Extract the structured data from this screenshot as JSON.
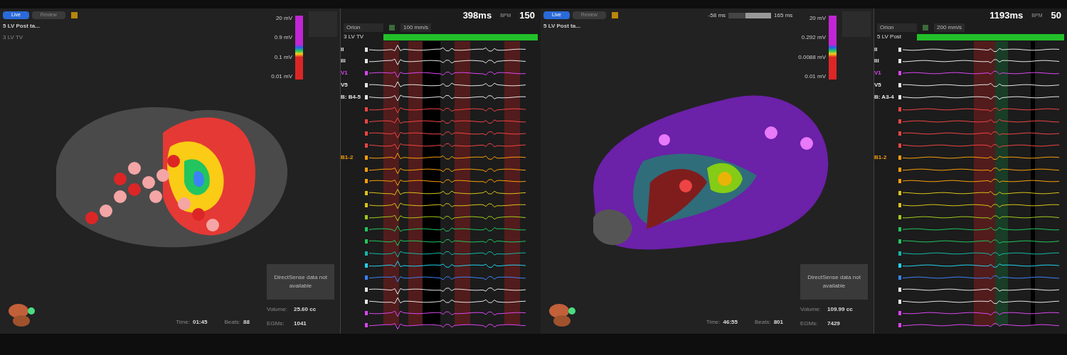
{
  "panels": [
    {
      "kind": "tissue",
      "modes": [
        {
          "label": "Live",
          "selected": true
        },
        {
          "label": "Review",
          "selected": false
        }
      ],
      "map_title": "5 LV Post ta...",
      "map_subtitle": "3 LV TV",
      "scale_labels": [
        "20 mV",
        "0.9 mV",
        "0.1 mV",
        "0.01 mV"
      ],
      "notice": "DirectSense data not available",
      "stats": [
        {
          "label": "Time:",
          "value": "01:45"
        },
        {
          "label": "Beats:",
          "value": "88"
        },
        {
          "label": "Volume:",
          "value": "25.60 cc"
        },
        {
          "label": "EGMs:",
          "value": "1041"
        }
      ],
      "egm": {
        "cl": "398ms",
        "bpm_label": "BPM",
        "bpm": "150",
        "catheter": "Orion",
        "speed": "100 mm/s",
        "channel": "3 LV TV",
        "leads": [
          {
            "label": "II",
            "color": "#e5e5e5"
          },
          {
            "label": "III",
            "color": "#e5e5e5"
          },
          {
            "label": "V1",
            "color": "#d946ef"
          },
          {
            "label": "V5",
            "color": "#e5e5e5"
          },
          {
            "label": "B: B4-5",
            "color": "#e5e5e5"
          },
          {
            "color": "#ef4444"
          },
          {
            "color": "#ef4444"
          },
          {
            "color": "#ef4444"
          },
          {
            "color": "#ef4444"
          },
          {
            "label": "B1-2",
            "color": "#f59e0b"
          },
          {
            "color": "#f59e0b"
          },
          {
            "color": "#f59e0b"
          },
          {
            "color": "#d9c21a"
          },
          {
            "color": "#d9c21a"
          },
          {
            "color": "#a3c91a"
          },
          {
            "color": "#22c55e"
          },
          {
            "color": "#22c55e"
          },
          {
            "color": "#14b8a6"
          },
          {
            "color": "#22d3ee"
          },
          {
            "color": "#3b82f6"
          },
          {
            "color": "#e5e5e5"
          },
          {
            "color": "#e5e5e5"
          },
          {
            "color": "#d946ef"
          },
          {
            "color": "#d946ef"
          }
        ]
      }
    },
    {
      "kind": "voltage",
      "modes": [
        {
          "label": "Live",
          "selected": true
        },
        {
          "label": "Review",
          "selected": false
        }
      ],
      "map_title": "5 LV Post ta...",
      "window": {
        "min": "-58 ms",
        "max": "165 ms",
        "level": 0.6
      },
      "scale_labels": [
        "20 mV",
        "0.292 mV",
        "0.0088 mV",
        "0.01 mV"
      ],
      "notice": "DirectSense data not available",
      "stats": [
        {
          "label": "Time:",
          "value": "46:55"
        },
        {
          "label": "Beats:",
          "value": "801"
        },
        {
          "label": "Volume:",
          "value": "109.99 cc"
        },
        {
          "label": "EGMs:",
          "value": "7429"
        }
      ],
      "egm": {
        "cl": "1193ms",
        "bpm_label": "BPM",
        "bpm": "50",
        "catheter": "Orion",
        "speed": "200 mm/s",
        "channel": "5 LV Post",
        "leads": [
          {
            "label": "II",
            "color": "#e5e5e5"
          },
          {
            "label": "III",
            "color": "#e5e5e5"
          },
          {
            "label": "V1",
            "color": "#d946ef"
          },
          {
            "label": "V5",
            "color": "#e5e5e5"
          },
          {
            "label": "B: A3-4",
            "color": "#e5e5e5"
          },
          {
            "color": "#ef4444"
          },
          {
            "color": "#ef4444"
          },
          {
            "color": "#ef4444"
          },
          {
            "color": "#ef4444"
          },
          {
            "label": "B1-2",
            "color": "#f59e0b"
          },
          {
            "color": "#f59e0b"
          },
          {
            "color": "#f59e0b"
          },
          {
            "color": "#d9c21a"
          },
          {
            "color": "#d9c21a"
          },
          {
            "color": "#a3c91a"
          },
          {
            "color": "#22c55e"
          },
          {
            "color": "#22c55e"
          },
          {
            "color": "#14b8a6"
          },
          {
            "color": "#22d3ee"
          },
          {
            "color": "#3b82f6"
          },
          {
            "color": "#e5e5e5"
          },
          {
            "color": "#e5e5e5"
          },
          {
            "color": "#d946ef"
          },
          {
            "color": "#d946ef"
          }
        ]
      }
    }
  ]
}
